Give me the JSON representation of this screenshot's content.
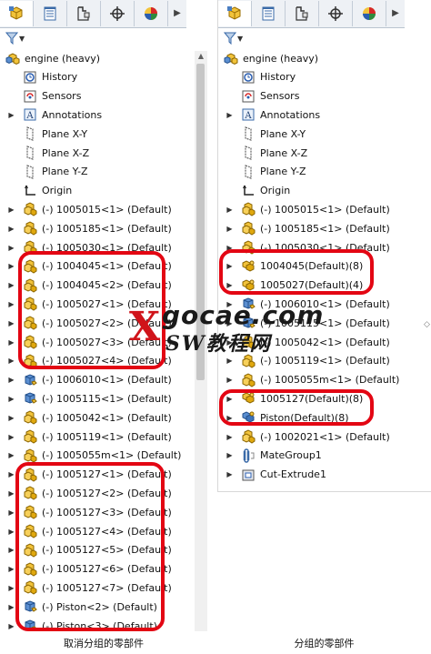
{
  "left": {
    "root": "engine  (heavy)",
    "rows": [
      {
        "label": "History",
        "icon": "history"
      },
      {
        "label": "Sensors",
        "icon": "sensor"
      },
      {
        "label": "Annotations",
        "icon": "annotation",
        "exp": true
      },
      {
        "label": "Plane X-Y",
        "icon": "plane"
      },
      {
        "label": "Plane X-Z",
        "icon": "plane"
      },
      {
        "label": "Plane Y-Z",
        "icon": "plane"
      },
      {
        "label": "Origin",
        "icon": "origin"
      },
      {
        "label": "(-) 1005015<1> (Default)",
        "icon": "part",
        "exp": true
      },
      {
        "label": "(-) 1005185<1> (Default)",
        "icon": "part",
        "exp": true
      },
      {
        "label": "(-) 1005030<1> (Default)",
        "icon": "part",
        "exp": true
      },
      {
        "label": "(-) 1004045<1> (Default)",
        "icon": "part",
        "exp": true
      },
      {
        "label": "(-) 1004045<2> (Default)",
        "icon": "part",
        "exp": true
      },
      {
        "label": "(-) 1005027<1> (Default)",
        "icon": "part",
        "exp": true
      },
      {
        "label": "(-) 1005027<2> (Default)",
        "icon": "part",
        "exp": true
      },
      {
        "label": "(-) 1005027<3> (Default)",
        "icon": "part",
        "exp": true
      },
      {
        "label": "(-) 1005027<4> (Default)",
        "icon": "part",
        "exp": true
      },
      {
        "label": "(-) 1006010<1> (Default)",
        "icon": "partblue",
        "exp": true
      },
      {
        "label": "(-) 1005115<1> (Default)",
        "icon": "partblue",
        "exp": true
      },
      {
        "label": "(-) 1005042<1> (Default)",
        "icon": "part",
        "exp": true
      },
      {
        "label": "(-) 1005119<1> (Default)",
        "icon": "part",
        "exp": true
      },
      {
        "label": "(-) 1005055m<1> (Default)",
        "icon": "part",
        "exp": true
      },
      {
        "label": "(-) 1005127<1> (Default)",
        "icon": "part",
        "exp": true
      },
      {
        "label": "(-) 1005127<2> (Default)",
        "icon": "part",
        "exp": true
      },
      {
        "label": "(-) 1005127<3> (Default)",
        "icon": "part",
        "exp": true
      },
      {
        "label": "(-) 1005127<4> (Default)",
        "icon": "part",
        "exp": true
      },
      {
        "label": "(-) 1005127<5> (Default)",
        "icon": "part",
        "exp": true
      },
      {
        "label": "(-) 1005127<6> (Default)",
        "icon": "part",
        "exp": true
      },
      {
        "label": "(-) 1005127<7> (Default)",
        "icon": "part",
        "exp": true
      },
      {
        "label": "(-) Piston<2> (Default)",
        "icon": "partblue",
        "exp": true
      },
      {
        "label": "(-) Piston<3> (Default)",
        "icon": "partblue",
        "exp": true
      }
    ],
    "caption": "取消分组的零部件"
  },
  "right": {
    "root": "engine  (heavy)",
    "rows": [
      {
        "label": "History",
        "icon": "history"
      },
      {
        "label": "Sensors",
        "icon": "sensor"
      },
      {
        "label": "Annotations",
        "icon": "annotation",
        "exp": true
      },
      {
        "label": "Plane X-Y",
        "icon": "plane"
      },
      {
        "label": "Plane X-Z",
        "icon": "plane"
      },
      {
        "label": "Plane Y-Z",
        "icon": "plane"
      },
      {
        "label": "Origin",
        "icon": "origin"
      },
      {
        "label": "(-) 1005015<1> (Default)",
        "icon": "part",
        "exp": true
      },
      {
        "label": "(-) 1005185<1> (Default)",
        "icon": "part",
        "exp": true
      },
      {
        "label": "(-) 1005030<1> (Default)",
        "icon": "part",
        "exp": true
      },
      {
        "label": "1004045(Default)(8)",
        "icon": "group",
        "exp": true
      },
      {
        "label": "1005027(Default)(4)",
        "icon": "group",
        "exp": true
      },
      {
        "label": "(-) 1006010<1> (Default)",
        "icon": "partblue",
        "exp": true
      },
      {
        "label": "(-) 1005115<1> (Default)",
        "icon": "partblue",
        "exp": true
      },
      {
        "label": "(-) 1005042<1> (Default)",
        "icon": "part",
        "exp": true
      },
      {
        "label": "(-) 1005119<1> (Default)",
        "icon": "part",
        "exp": true
      },
      {
        "label": "(-) 1005055m<1> (Default)",
        "icon": "part",
        "exp": true
      },
      {
        "label": "1005127(Default)(8)",
        "icon": "group",
        "exp": true
      },
      {
        "label": "Piston(Default)(8)",
        "icon": "groupblue",
        "exp": true
      },
      {
        "label": "(-) 1002021<1> (Default)",
        "icon": "part",
        "exp": true
      },
      {
        "label": "MateGroup1",
        "icon": "mate",
        "exp": true
      },
      {
        "label": "Cut-Extrude1",
        "icon": "cut",
        "exp": true
      }
    ],
    "caption": "分组的零部件"
  },
  "tabs": [
    "feature-manager",
    "property-manager",
    "configuration-manager",
    "dim-xpert",
    "display-manager"
  ],
  "watermark": {
    "top": "gocae.com",
    "bottom": "SW教程网",
    "mark": "X"
  },
  "colors": {
    "highlight": "#e30613",
    "part": "#e7b21a",
    "blue": "#4a7ec2"
  }
}
